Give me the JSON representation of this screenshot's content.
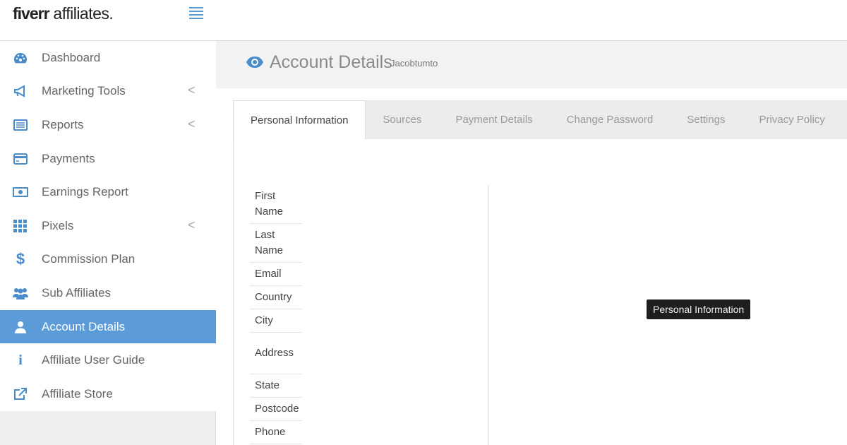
{
  "brand": {
    "logo_bold": "fiverr",
    "logo_rest": " affiliates."
  },
  "sidebar": {
    "items": [
      {
        "label": "Dashboard",
        "icon": "dashboard-icon",
        "chevron": false
      },
      {
        "label": "Marketing Tools",
        "icon": "megaphone-icon",
        "chevron": true
      },
      {
        "label": "Reports",
        "icon": "list-icon",
        "chevron": true
      },
      {
        "label": "Payments",
        "icon": "credit-card-icon",
        "chevron": false
      },
      {
        "label": "Earnings Report",
        "icon": "money-icon",
        "chevron": false
      },
      {
        "label": "Pixels",
        "icon": "grid-icon",
        "chevron": true
      },
      {
        "label": "Commission Plan",
        "icon": "dollar-icon",
        "chevron": false
      },
      {
        "label": "Sub Affiliates",
        "icon": "users-icon",
        "chevron": false
      },
      {
        "label": "Account Details",
        "icon": "user-icon",
        "chevron": false,
        "active": true
      },
      {
        "label": "Affiliate User Guide",
        "icon": "info-icon",
        "chevron": false
      },
      {
        "label": "Affiliate Store",
        "icon": "external-link-icon",
        "chevron": false
      }
    ],
    "chevron_glyph": "<"
  },
  "header": {
    "title": "Account Details",
    "subtitle": "Jacobtumto"
  },
  "tabs": [
    {
      "label": "Personal Information",
      "active": true
    },
    {
      "label": "Sources"
    },
    {
      "label": "Payment Details"
    },
    {
      "label": "Change Password"
    },
    {
      "label": "Settings"
    },
    {
      "label": "Privacy Policy"
    }
  ],
  "form": {
    "fields": [
      "First Name",
      "Last Name",
      "Email",
      "Country",
      "City",
      "Address",
      "State",
      "Postcode",
      "Phone"
    ]
  },
  "tooltip": {
    "text": "Personal Information"
  },
  "colors": {
    "accent": "#5b9bd8",
    "sidebar_bg": "#eeeeee",
    "header_bg": "#f2f2f2"
  }
}
